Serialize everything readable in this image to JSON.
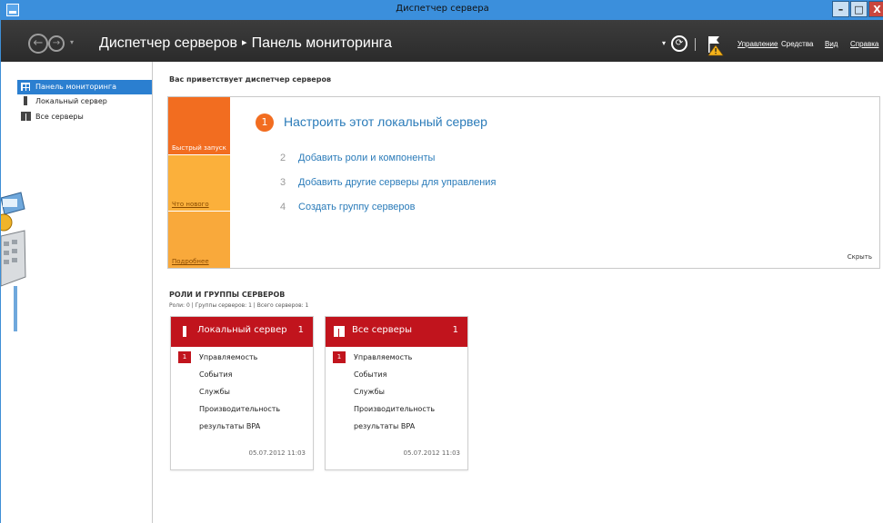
{
  "window": {
    "title": "Диспетчер сервера"
  },
  "window_controls": {
    "minimize": "–",
    "maximize": "□",
    "close": "X"
  },
  "header": {
    "breadcrumb": [
      "Диспетчер серверов",
      "Панель мониторинга"
    ],
    "breadcrumb_separator": "▸",
    "menu": [
      "Управление",
      "Средства",
      "Вид",
      "Справка"
    ],
    "icons": [
      "back-icon",
      "forward-icon",
      "refresh-icon",
      "notifications-flag-icon"
    ]
  },
  "sidebar": {
    "items": [
      {
        "label": "Панель мониторинга",
        "icon": "dashboard-icon",
        "active": true
      },
      {
        "label": "Локальный сервер",
        "icon": "server-icon",
        "active": false
      },
      {
        "label": "Все серверы",
        "icon": "servers-icon",
        "active": false
      }
    ]
  },
  "welcome": {
    "title": "Вас приветствует диспетчер серверов",
    "tiles": [
      "Быстрый запуск",
      "Что нового",
      "Подробнее"
    ],
    "main_step": {
      "num": "1",
      "label": "Настроить этот локальный сервер"
    },
    "steps": [
      {
        "num": "2",
        "label": "Добавить роли и компоненты"
      },
      {
        "num": "3",
        "label": "Добавить другие серверы для управления"
      },
      {
        "num": "4",
        "label": "Создать группу серверов"
      }
    ],
    "hide": "Скрыть"
  },
  "roles": {
    "title": "РОЛИ И ГРУППЫ СЕРВЕРОВ",
    "subtitle": "Роли: 0 | Группы серверов: 1 | Всего серверов: 1",
    "tiles": [
      {
        "name": "Локальный сервер",
        "count": "1",
        "rows": [
          {
            "label": "Управляемость",
            "badge": "1"
          },
          {
            "label": "События",
            "badge": ""
          },
          {
            "label": "Службы",
            "badge": ""
          },
          {
            "label": "Производительность",
            "badge": ""
          },
          {
            "label": "результаты BPA",
            "badge": ""
          }
        ],
        "date": "05.07.2012 11:03"
      },
      {
        "name": "Все серверы",
        "count": "1",
        "rows": [
          {
            "label": "Управляемость",
            "badge": "1"
          },
          {
            "label": "События",
            "badge": ""
          },
          {
            "label": "Службы",
            "badge": ""
          },
          {
            "label": "Производительность",
            "badge": ""
          },
          {
            "label": "результаты BPA",
            "badge": ""
          }
        ],
        "date": "05.07.2012 11:03"
      }
    ]
  },
  "colors": {
    "titlebar": "#3b8fdc",
    "header": "#2f2f2f",
    "accent_orange": "#f26d20",
    "tile_red": "#c1141d",
    "link_blue": "#2a7bb9",
    "sidebar_active": "#2b7fd0"
  }
}
